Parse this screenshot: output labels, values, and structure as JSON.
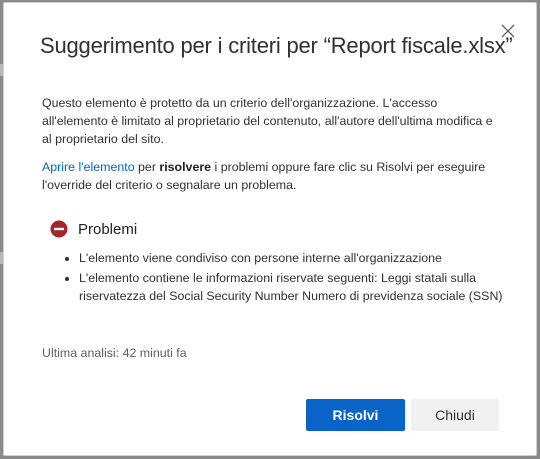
{
  "dialog": {
    "title": "Suggerimento per i criteri per “Report fiscale.xlsx”",
    "description": "Questo elemento è protetto da un criterio dell'organizzazione. L'accesso all'elemento è limitato al proprietario del contenuto, all'autore dell'ultima modifica e al proprietario del sito.",
    "action_line": {
      "link_text": "Aprire l'elemento",
      "text_before_bold": " per ",
      "bold_text": "risolvere",
      "text_after_bold": " i problemi oppure fare clic su Risolvi per eseguire l'override del criterio o segnalare un problema."
    },
    "issues": {
      "heading": "Problemi",
      "icon": "block-icon",
      "icon_color": "#a4262c",
      "items": [
        "L'elemento viene condiviso con persone interne all'organizzazione",
        "L'elemento contiene le informazioni riservate seguenti: Leggi statali sulla riservatezza del Social Security Number Numero di previdenza sociale (SSN)"
      ]
    },
    "last_scan": "Ultima analisi: 42 minuti fa",
    "buttons": {
      "primary": "Risolvi",
      "secondary": "Chiudi"
    },
    "colors": {
      "primary_button": "#0a64c8",
      "link": "#0067b8",
      "secondary_button": "#f1f1f1"
    }
  }
}
